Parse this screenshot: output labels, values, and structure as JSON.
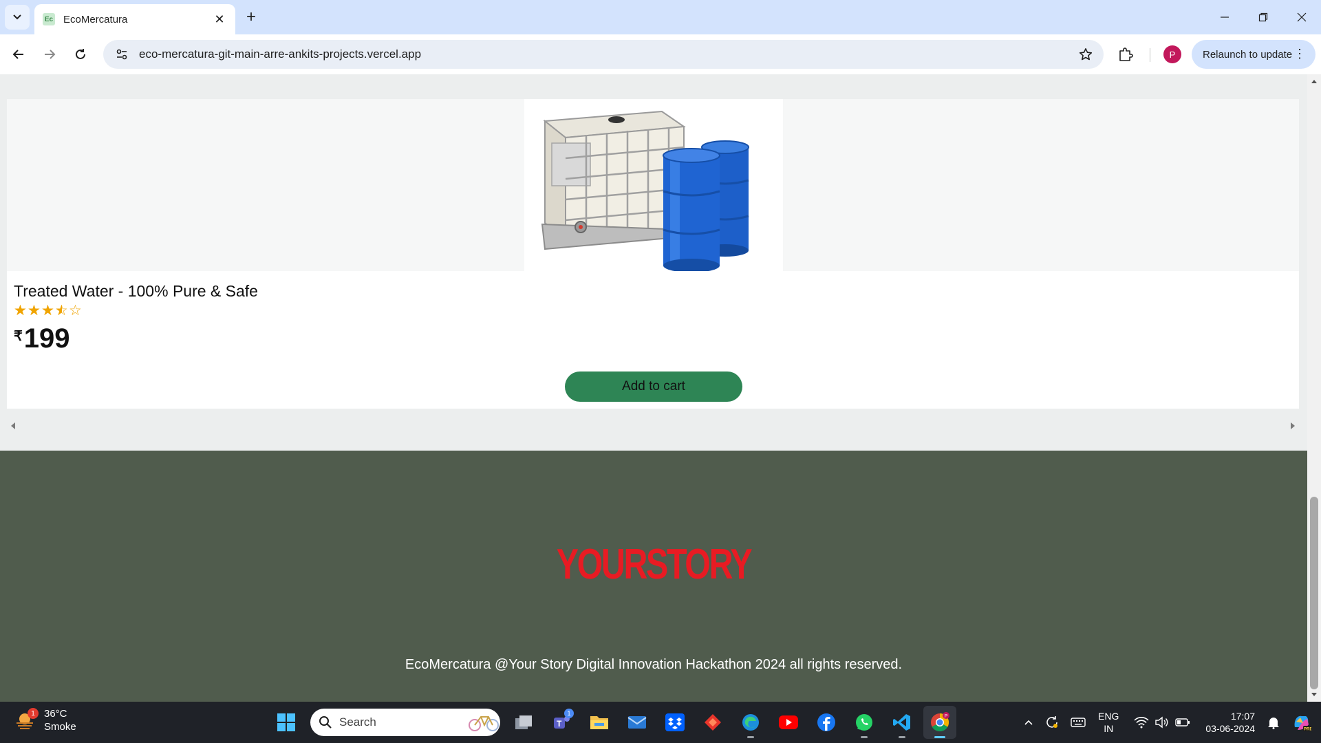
{
  "browser": {
    "tab_title": "EcoMercatura",
    "tab_favicon_text": "Ec",
    "url": "eco-mercatura-git-main-arre-ankits-projects.vercel.app",
    "profile_initial": "P",
    "relaunch_label": "Relaunch to update"
  },
  "product": {
    "title": "Treated Water - 100% Pure & Safe",
    "rating": 3.5,
    "rating_max": 5,
    "currency_symbol": "₹",
    "price": "199",
    "add_to_cart_label": "Add to cart"
  },
  "footer": {
    "logo_text": "YOURSTORY",
    "copyright": "EcoMercatura @Your Story Digital Innovation Hackathon 2024 all rights reserved."
  },
  "taskbar": {
    "weather_badge": "1",
    "temperature": "36°C",
    "condition": "Smoke",
    "search_placeholder": "Search",
    "teams_badge": "1",
    "lang_line1": "ENG",
    "lang_line2": "IN",
    "time": "17:07",
    "date": "03-06-2024"
  },
  "colors": {
    "accent_green": "#2e8555",
    "footer_bg": "#505c4d",
    "logo_red": "#e81b23",
    "star_gold": "#f0a400"
  }
}
